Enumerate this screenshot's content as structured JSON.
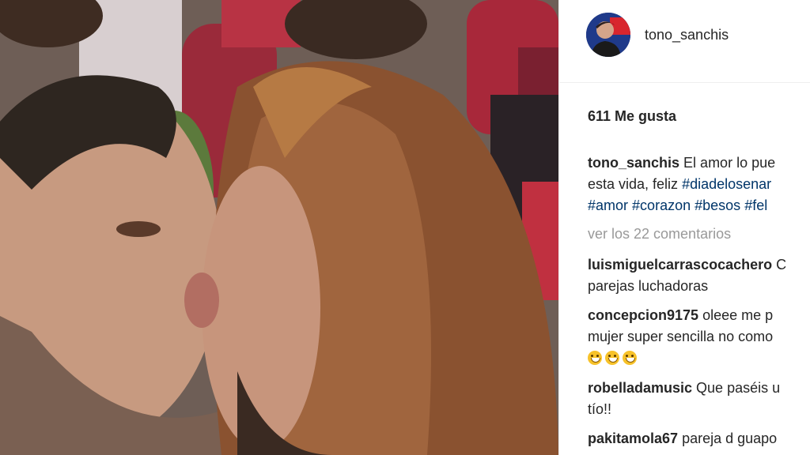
{
  "post": {
    "username": "tono_sanchis",
    "likes": "611 Me gusta",
    "caption": {
      "username": "tono_sanchis",
      "line1": "El amor lo pue",
      "line2_text": "esta vida, feliz ",
      "line2_tag": "#diadelosenar",
      "tags_line3": [
        "#amor",
        "#corazon",
        "#besos",
        "#fel"
      ]
    },
    "view_all_comments": "ver los 22 comentarios",
    "comments": [
      {
        "user": "luismiguelcarrascocachero",
        "line1": " C",
        "line2": "parejas luchadoras"
      },
      {
        "user": "concepcion9175",
        "line1": " oleee me p",
        "line2": "mujer super sencilla no como",
        "emoji_count": 3
      },
      {
        "user": "robelladamusic",
        "line1": " Que paséis u",
        "line2": "tío!!"
      },
      {
        "user": "pakitamola67",
        "line1": " pareja d guapo"
      }
    ]
  }
}
